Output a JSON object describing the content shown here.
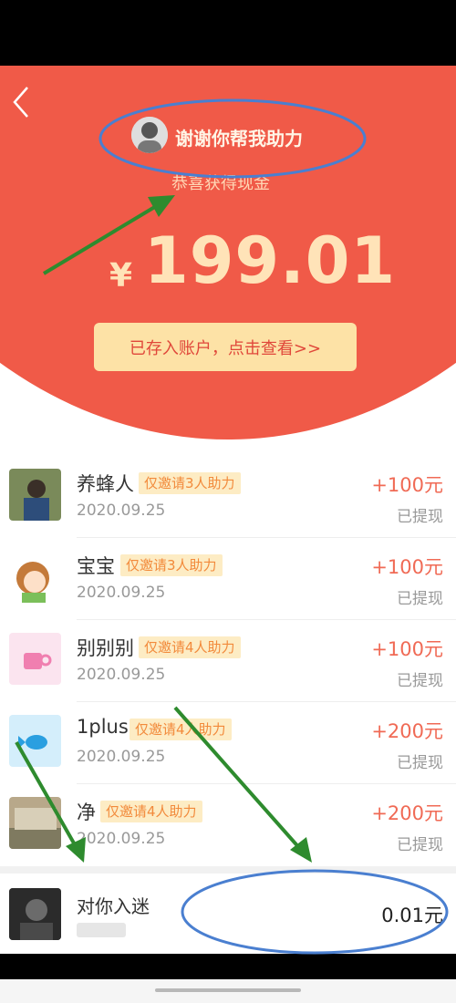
{
  "header": {
    "title": "谢谢你帮我助力",
    "subtitle": "恭喜获得现金",
    "currency": "¥",
    "amount": "199.01",
    "cta_label": "已存入账户，点击查看>>"
  },
  "helpers": [
    {
      "name": "养蜂人",
      "tag": "仅邀请3人助力",
      "date": "2020.09.25",
      "amount": "+100元",
      "status": "已提现"
    },
    {
      "name": "宝宝",
      "tag": "仅邀请3人助力",
      "date": "2020.09.25",
      "amount": "+100元",
      "status": "已提现"
    },
    {
      "name": "别别别",
      "tag": "仅邀请4人助力",
      "date": "2020.09.25",
      "amount": "+100元",
      "status": "已提现"
    },
    {
      "name": "1plus",
      "tag": "仅邀请4人助力",
      "date": "2020.09.25",
      "amount": "+200元",
      "status": "已提现"
    },
    {
      "name": "净",
      "tag": "仅邀请4人助力",
      "date": "2020.09.25",
      "amount": "+200元",
      "status": "已提现"
    }
  ],
  "last_helper": {
    "name": "对你入迷",
    "amount": "0.01元"
  },
  "colors": {
    "hero": "#f05a48",
    "cta": "#fde2a6",
    "amount_red": "#f06a55",
    "tag_bg": "#fdecc4",
    "annotation_blue": "#4a7fd0",
    "annotation_green": "#2e8b2e"
  }
}
